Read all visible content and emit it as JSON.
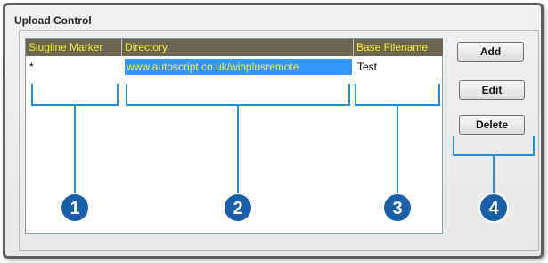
{
  "panel": {
    "title": "Upload Control"
  },
  "listview": {
    "columns": [
      "Slugline Marker",
      "Directory",
      "Base Filename"
    ],
    "rows": [
      {
        "marker": "*",
        "directory": "www.autoscript.co.uk/winplusremote",
        "filename": "Test"
      }
    ]
  },
  "buttons": {
    "add": "Add",
    "edit": "Edit",
    "delete": "Delete"
  },
  "callouts": {
    "labels": [
      "1",
      "2",
      "3",
      "4"
    ],
    "color": "#1b5fa8",
    "bracket_color": "#2a8fd6"
  },
  "colors": {
    "header_bg": "#6c6650",
    "header_text": "#f3ec2f",
    "selection_bg": "#3399ff"
  }
}
